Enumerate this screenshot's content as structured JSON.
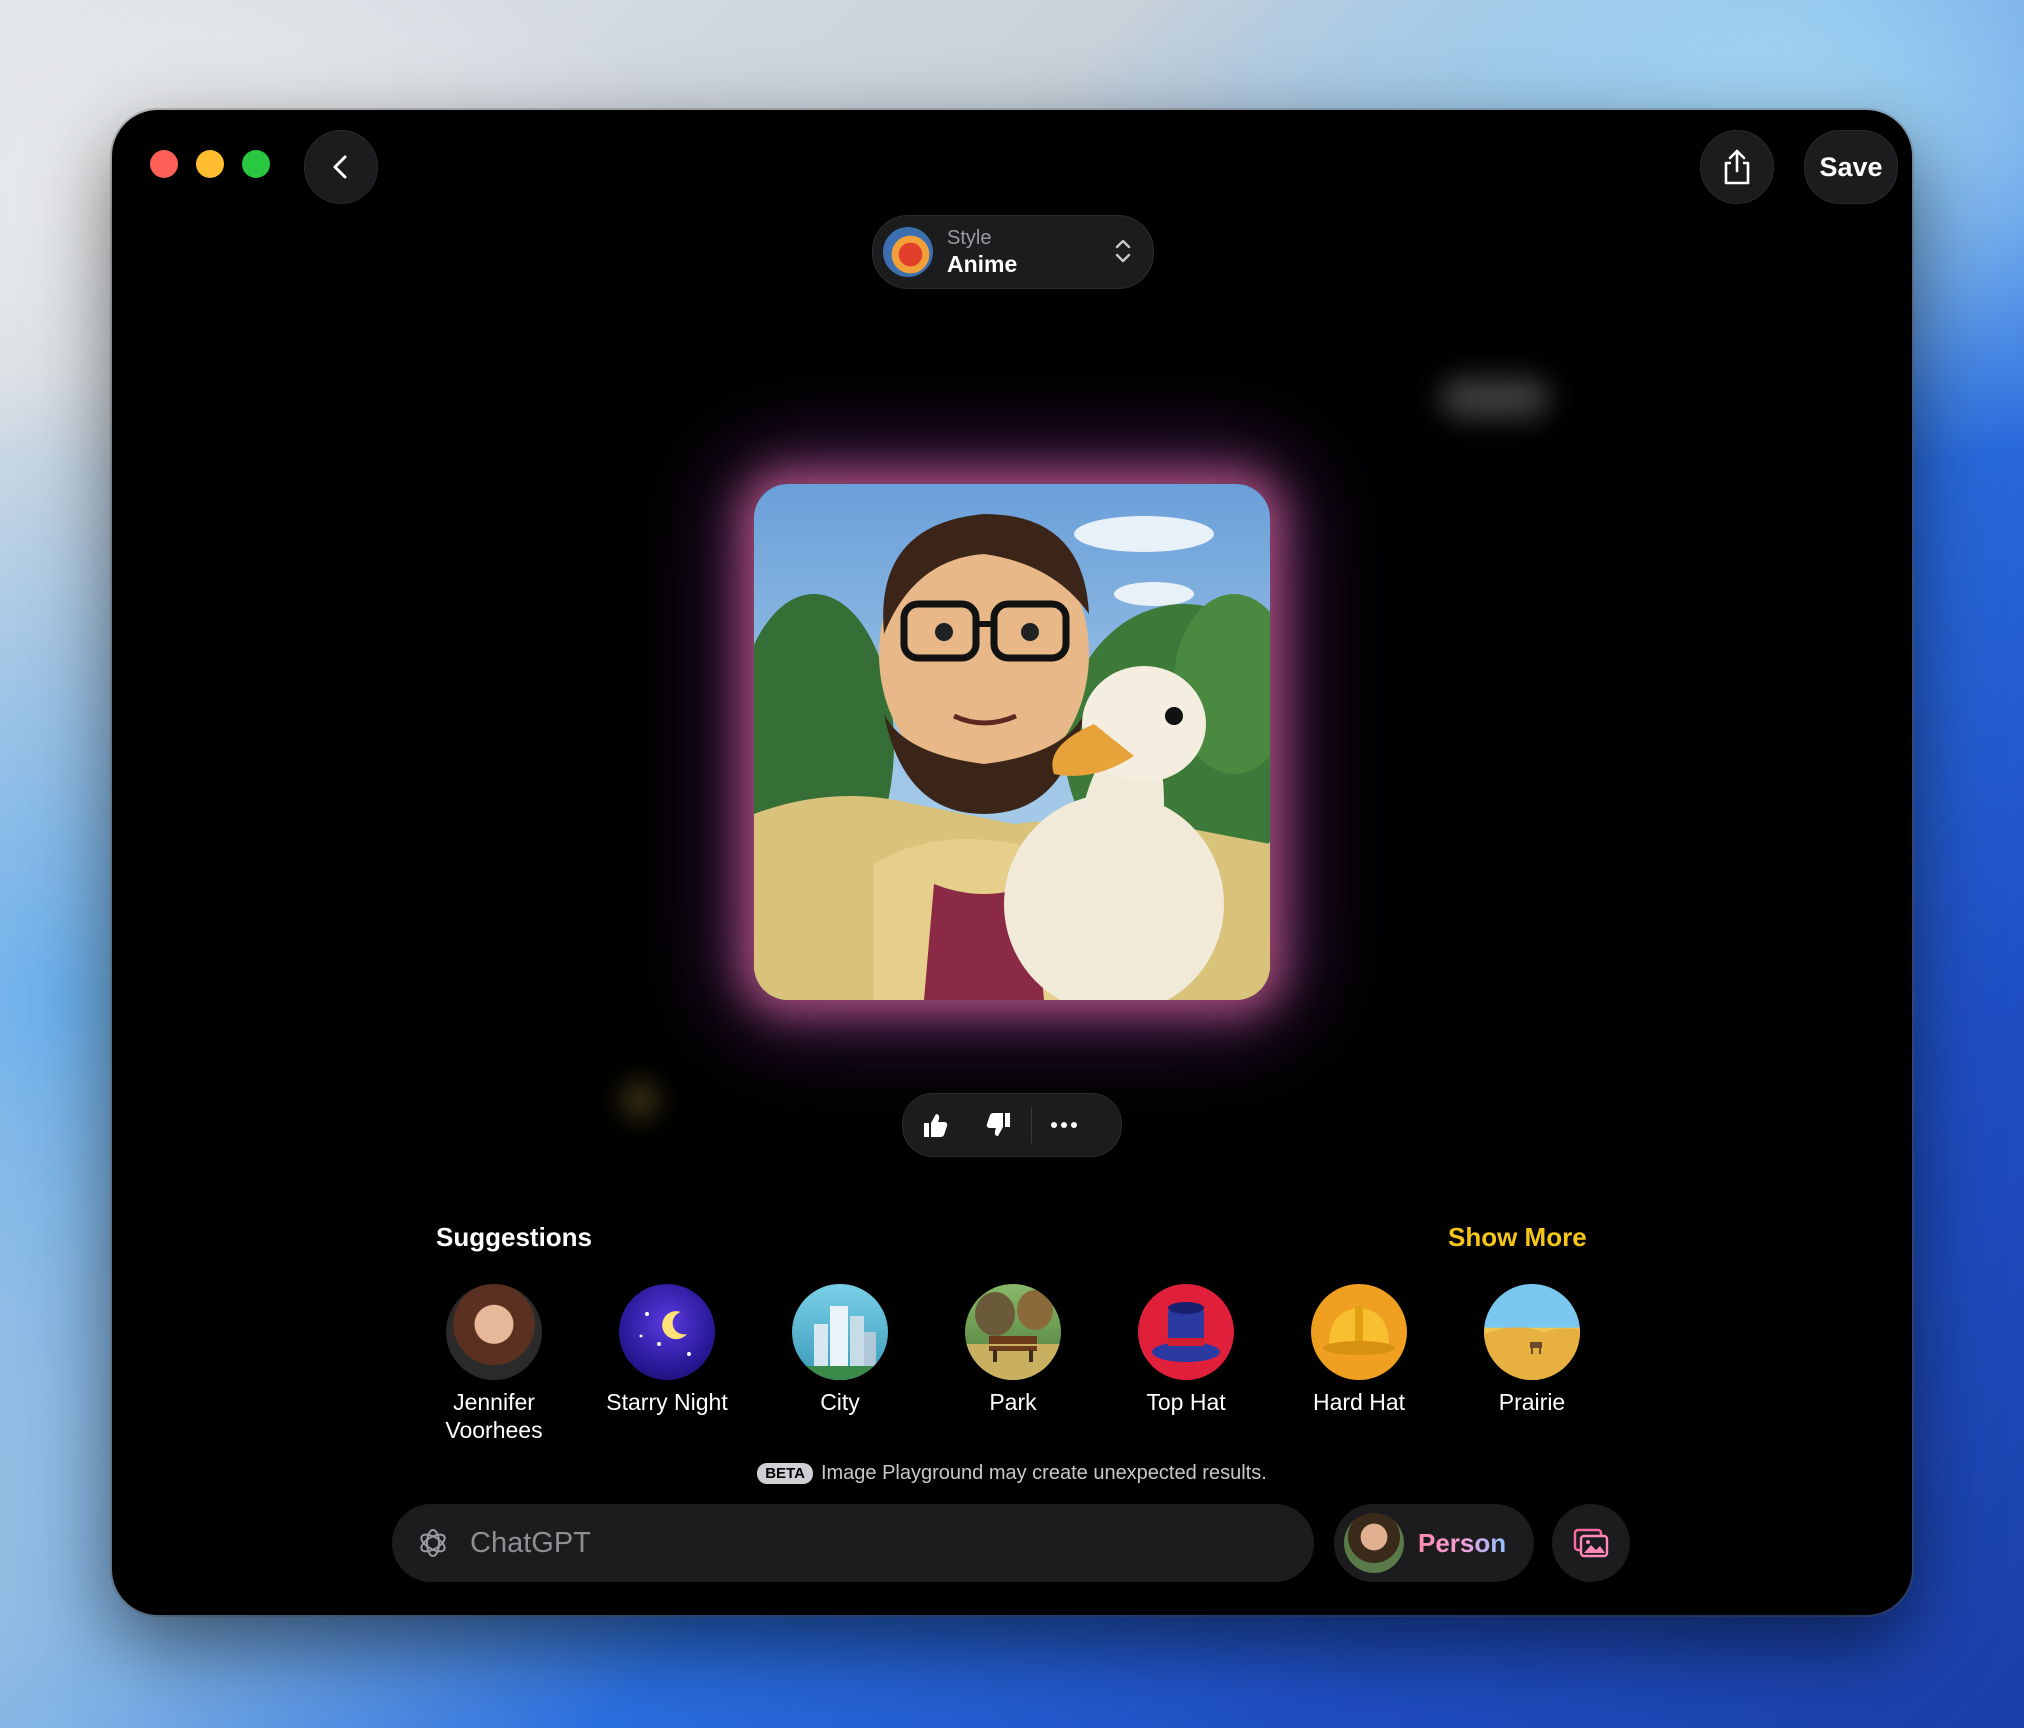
{
  "window": {
    "save_label": "Save"
  },
  "style_picker": {
    "label": "Style",
    "value": "Anime"
  },
  "suggestions": {
    "title": "Suggestions",
    "show_more": "Show More",
    "items": [
      {
        "label": "Jennifer Voorhees",
        "icon": "person-photo"
      },
      {
        "label": "Starry Night",
        "icon": "night-sky"
      },
      {
        "label": "City",
        "icon": "city-buildings"
      },
      {
        "label": "Park",
        "icon": "park-bench"
      },
      {
        "label": "Top Hat",
        "icon": "top-hat"
      },
      {
        "label": "Hard Hat",
        "icon": "hard-hat"
      },
      {
        "label": "Prairie",
        "icon": "prairie-landscape"
      }
    ]
  },
  "notice": {
    "badge": "BETA",
    "text": "Image Playground may create unexpected results."
  },
  "prompt": {
    "placeholder": "ChatGPT"
  },
  "person_chip": {
    "label": "Person"
  },
  "colors": {
    "accent_yellow": "#f5c518",
    "window_bg": "#000000",
    "control_bg": "#1c1c1e"
  }
}
